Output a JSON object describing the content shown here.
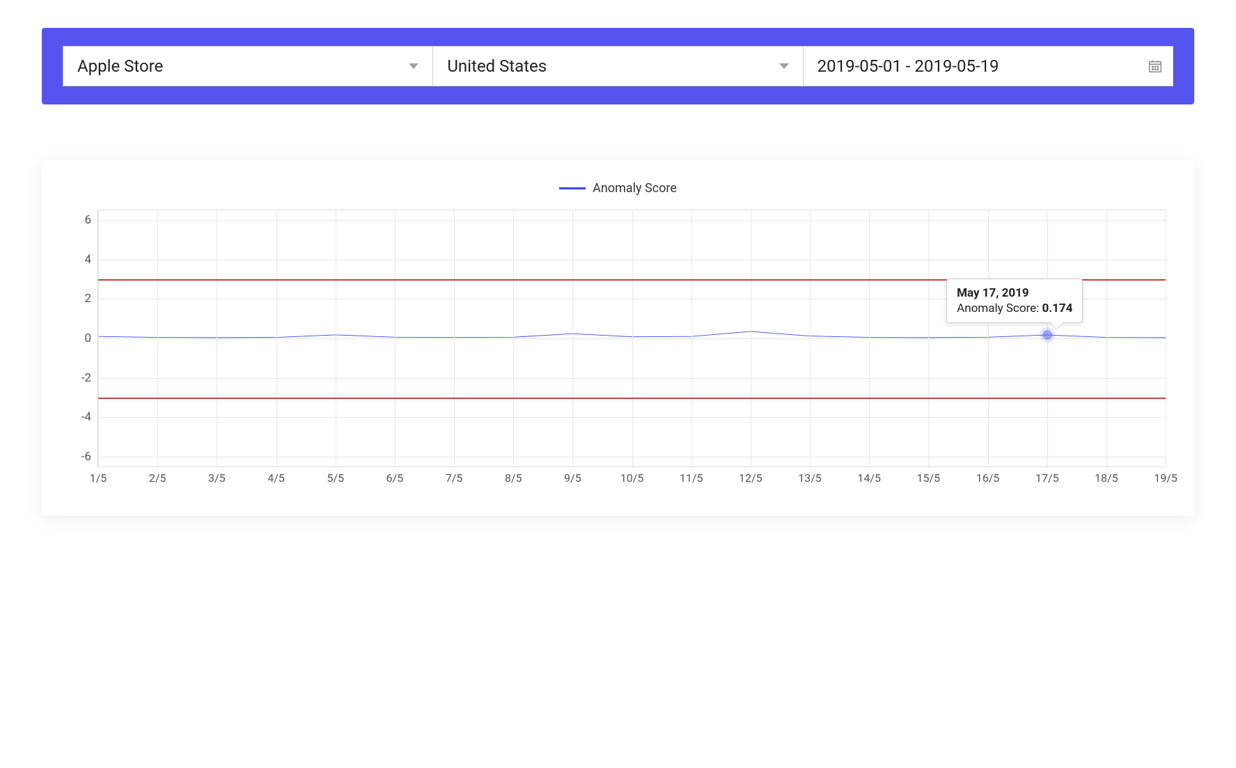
{
  "filters": {
    "store": "Apple Store",
    "country": "United States",
    "date_range": "2019-05-01 - 2019-05-19"
  },
  "legend": {
    "series_name": "Anomaly Score"
  },
  "tooltip": {
    "date": "May 17, 2019",
    "label": "Anomaly Score: ",
    "value": "0.174"
  },
  "chart_data": {
    "type": "line",
    "ylabel": "",
    "xlabel": "",
    "ylim": [
      -6.5,
      6.5
    ],
    "y_ticks": [
      -6,
      -4,
      -2,
      0,
      2,
      4,
      6
    ],
    "thresholds": [
      3,
      -3
    ],
    "categories": [
      "1/5",
      "2/5",
      "3/5",
      "4/5",
      "5/5",
      "6/5",
      "7/5",
      "8/5",
      "9/5",
      "10/5",
      "11/5",
      "12/5",
      "13/5",
      "14/5",
      "15/5",
      "16/5",
      "17/5",
      "18/5",
      "19/5"
    ],
    "series": [
      {
        "name": "Anomaly Score",
        "color": "#3a46ff",
        "values": [
          0.1,
          0.05,
          0.04,
          0.05,
          0.18,
          0.06,
          0.05,
          0.06,
          0.24,
          0.08,
          0.1,
          0.35,
          0.12,
          0.05,
          0.04,
          0.06,
          0.174,
          0.05,
          0.04
        ]
      }
    ],
    "highlight": {
      "index": 16,
      "date": "May 17, 2019",
      "value": 0.174
    }
  }
}
